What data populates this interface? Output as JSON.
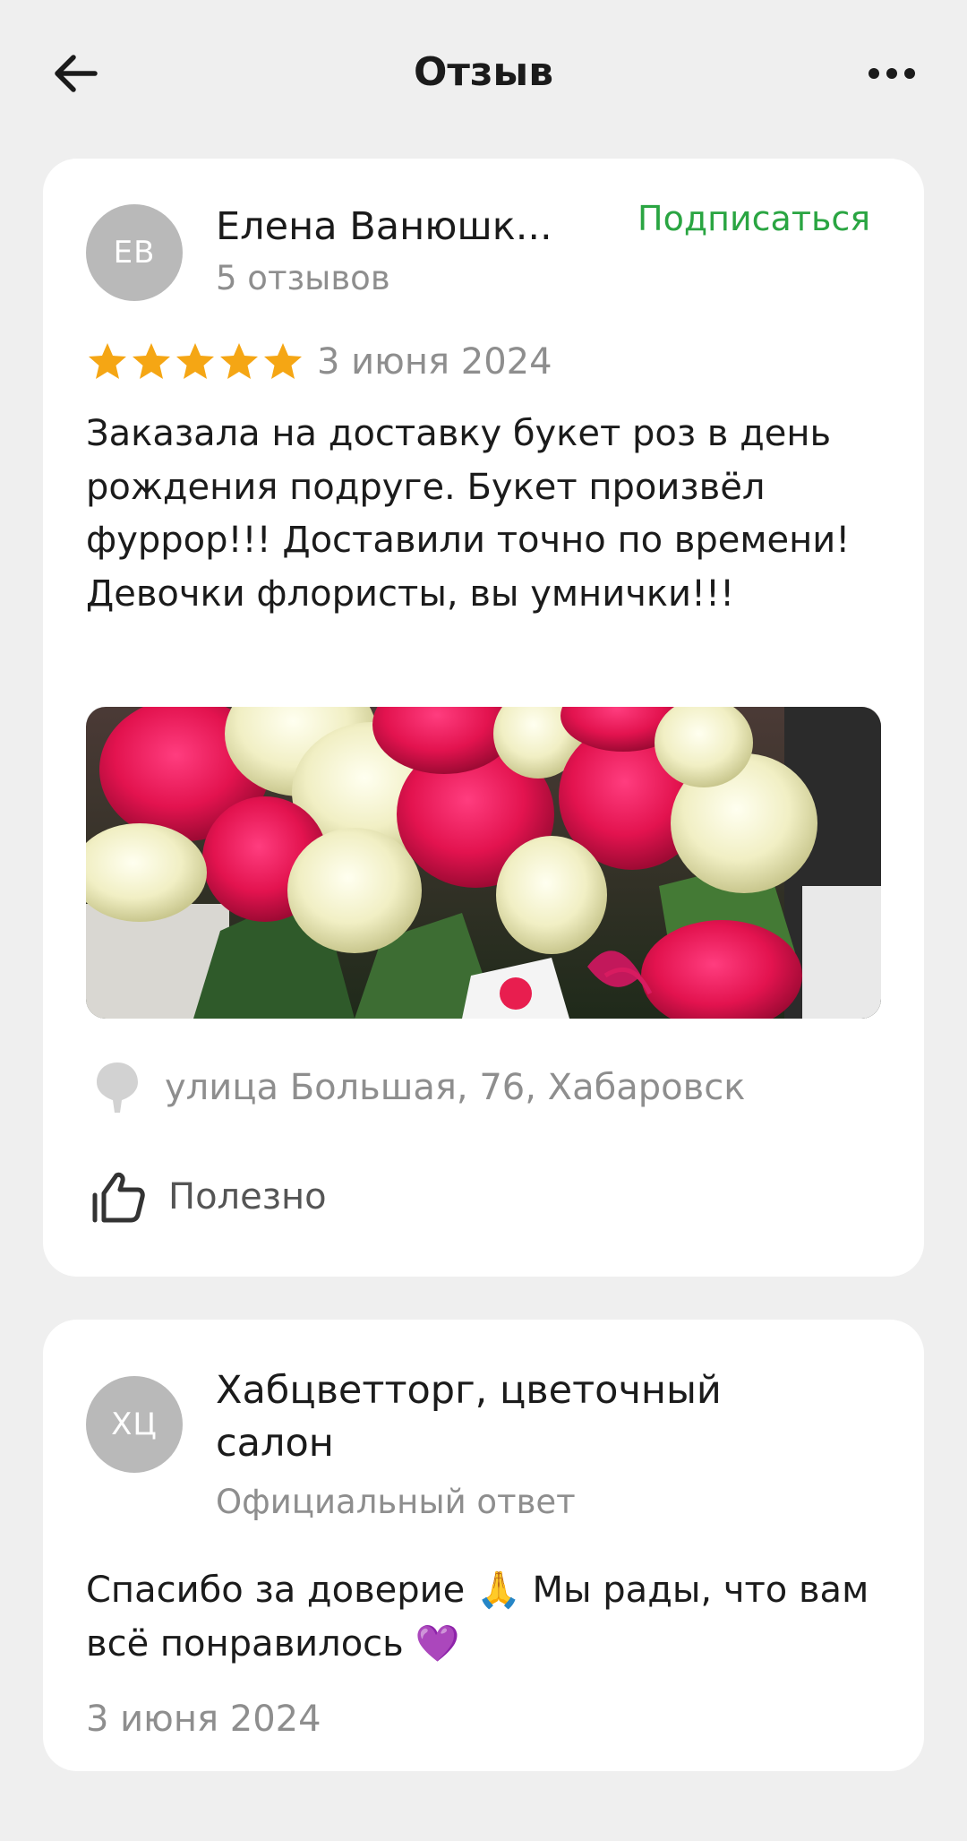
{
  "header": {
    "title": "Отзыв",
    "back_icon": "arrow-left-icon",
    "more_icon": "more-horizontal-icon"
  },
  "review": {
    "avatar_initials": "ЕВ",
    "author_name": "Елена Ванюшк...",
    "author_reviews": "5 отзывов",
    "subscribe_label": "Подписаться",
    "rating": 5,
    "rating_max": 5,
    "date": "3 июня 2024",
    "text": "Заказала на доставку букет роз в день рождения подруге. Букет произвёл фуррор!!! Доставили точно по времени! Девочки флористы, вы умнички!!!",
    "photo_icon": "roses-bouquet-photo",
    "address": "улица Большая, 76, Хабаровск",
    "address_icon": "location-pin-icon",
    "useful_label": "Полезно",
    "useful_icon": "thumbs-up-icon"
  },
  "reply": {
    "avatar_initials": "ХЦ",
    "org_name": "Хабцветторг, цветочный салон",
    "subtitle": "Официальный ответ",
    "text": "Спасибо за доверие 🙏 Мы рады, что вам всё понравилось 💜",
    "date": "3 июня 2024"
  },
  "colors": {
    "background": "#efefef",
    "card": "#ffffff",
    "accent_green": "#2aa542",
    "star": "#f5a614",
    "secondary_text": "#8e8e8e",
    "avatar": "#b9b9b9"
  }
}
